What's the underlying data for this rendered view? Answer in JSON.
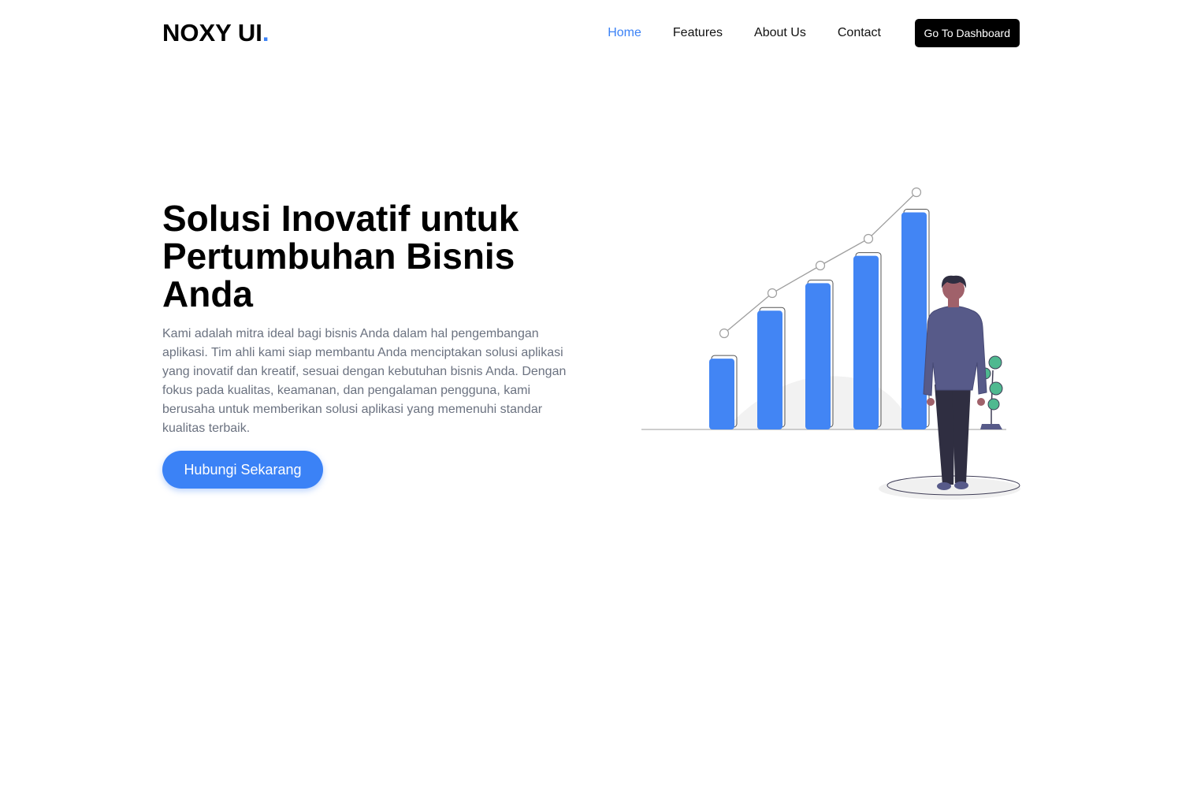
{
  "header": {
    "logo_text": "NOXY UI",
    "logo_dot": ".",
    "nav": [
      {
        "label": "Home",
        "active": true
      },
      {
        "label": "Features",
        "active": false
      },
      {
        "label": "About Us",
        "active": false
      },
      {
        "label": "Contact",
        "active": false
      }
    ],
    "dashboard_button": "Go To Dashboard"
  },
  "hero": {
    "title": "Solusi Inovatif untuk Pertumbuhan Bisnis Anda",
    "description": "Kami adalah mitra ideal bagi bisnis Anda dalam hal pengembangan aplikasi. Tim ahli kami siap membantu Anda menciptakan solusi aplikasi yang inovatif dan kreatif, sesuai dengan kebutuhan bisnis Anda. Dengan fokus pada kualitas, keamanan, dan pengalaman pengguna, kami berusaha untuk memberikan solusi aplikasi yang memenuhi standar kualitas terbaik.",
    "cta_button": "Hubungi Sekarang"
  },
  "illustration": {
    "name": "growth-chart-illustration",
    "relative_bar_values": [
      0.31,
      0.52,
      0.64,
      0.76,
      0.95
    ],
    "colors": {
      "bar": "#4285f4",
      "plant": "#4fb990",
      "suit": "#575a89",
      "pants": "#2f2e41",
      "hair": "#2f2e41",
      "accent": "#3b82f6"
    }
  }
}
